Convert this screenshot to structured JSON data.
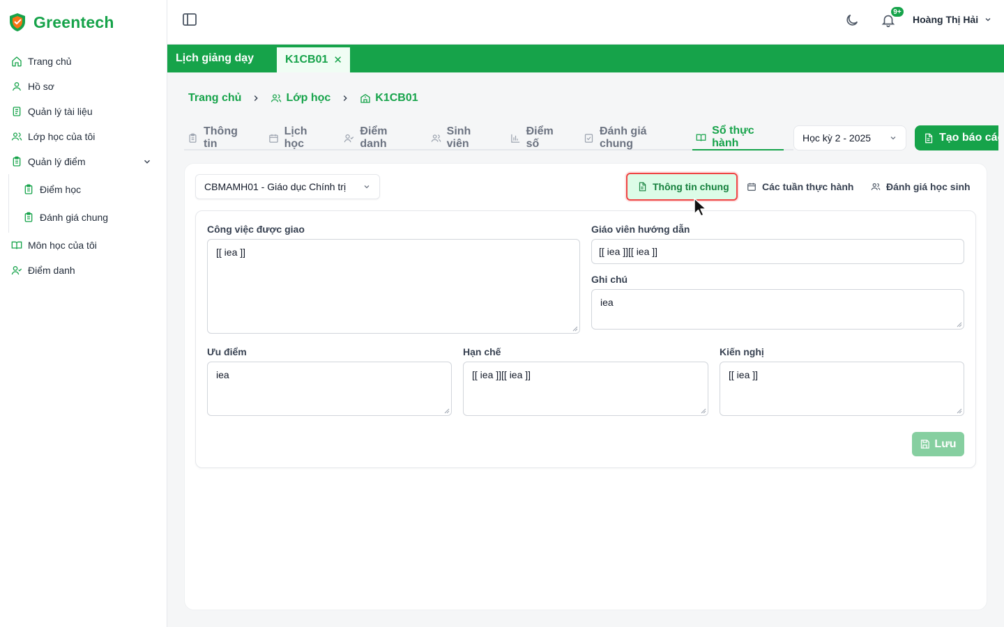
{
  "brand": {
    "name": "Greentech",
    "logo_icon": "shield-logo-icon"
  },
  "sidebar": {
    "items": [
      {
        "label": "Trang chủ",
        "icon": "home-icon"
      },
      {
        "label": "Hồ sơ",
        "icon": "user-icon"
      },
      {
        "label": "Quản lý tài liệu",
        "icon": "document-icon"
      },
      {
        "label": "Lớp học của tôi",
        "icon": "users-icon"
      },
      {
        "label": "Quản lý điểm",
        "icon": "clipboard-icon",
        "expanded": true,
        "children": [
          {
            "label": "Điểm học",
            "icon": "clipboard-icon"
          },
          {
            "label": "Đánh giá chung",
            "icon": "clipboard-icon"
          }
        ]
      },
      {
        "label": "Môn học của tôi",
        "icon": "book-icon"
      },
      {
        "label": "Điểm danh",
        "icon": "user-check-icon"
      }
    ]
  },
  "header": {
    "notification_badge": "9+",
    "user_name": "Hoàng Thị Hải"
  },
  "tabstrip": {
    "tabs": [
      {
        "label": "Lịch giảng dạy"
      },
      {
        "label": "K1CB01",
        "closable": true,
        "close_glyph": "✕"
      }
    ]
  },
  "breadcrumb": [
    "Trang chủ",
    "Lớp học",
    "K1CB01"
  ],
  "page_tabs": [
    {
      "label": "Thông tin",
      "icon": "clipboard-icon"
    },
    {
      "label": "Lịch học",
      "icon": "calendar-icon"
    },
    {
      "label": "Điểm danh",
      "icon": "user-check-icon"
    },
    {
      "label": "Sinh viên",
      "icon": "users-icon"
    },
    {
      "label": "Điểm số",
      "icon": "bar-chart-icon"
    },
    {
      "label": "Đánh giá chung",
      "icon": "check-square-icon"
    },
    {
      "label": "Sổ thực hành",
      "icon": "book-open-icon",
      "active": true
    }
  ],
  "semester_select": {
    "value": "Học kỳ 2 - 2025"
  },
  "report_button": {
    "label": "Tạo báo cáo"
  },
  "subject_select": {
    "value": "CBMAMH01 - Giáo dục Chính trị"
  },
  "segments": [
    {
      "label": "Thông tin chung",
      "icon": "file-text-icon",
      "active": true
    },
    {
      "label": "Các tuần thực hành",
      "icon": "calendar-icon"
    },
    {
      "label": "Đánh giá học sinh",
      "icon": "users-icon"
    }
  ],
  "form": {
    "assigned_work": {
      "label": "Công việc được giao",
      "value": "[[ iea ]]"
    },
    "instructor": {
      "label": "Giáo viên hướng dẫn",
      "value": "[[ iea ]][[ iea ]]"
    },
    "note": {
      "label": "Ghi chú",
      "value": "iea"
    },
    "strengths": {
      "label": "Ưu điểm",
      "value": "iea"
    },
    "limitations": {
      "label": "Hạn chế",
      "value": "[[ iea ]][[ iea ]]"
    },
    "recommendations": {
      "label": "Kiến nghị",
      "value": "[[ iea ]]"
    },
    "save_label": "Lưu"
  },
  "colors": {
    "brand": "#16a34a",
    "highlight_border": "#ef4444",
    "active_bg": "#dcfce7"
  }
}
